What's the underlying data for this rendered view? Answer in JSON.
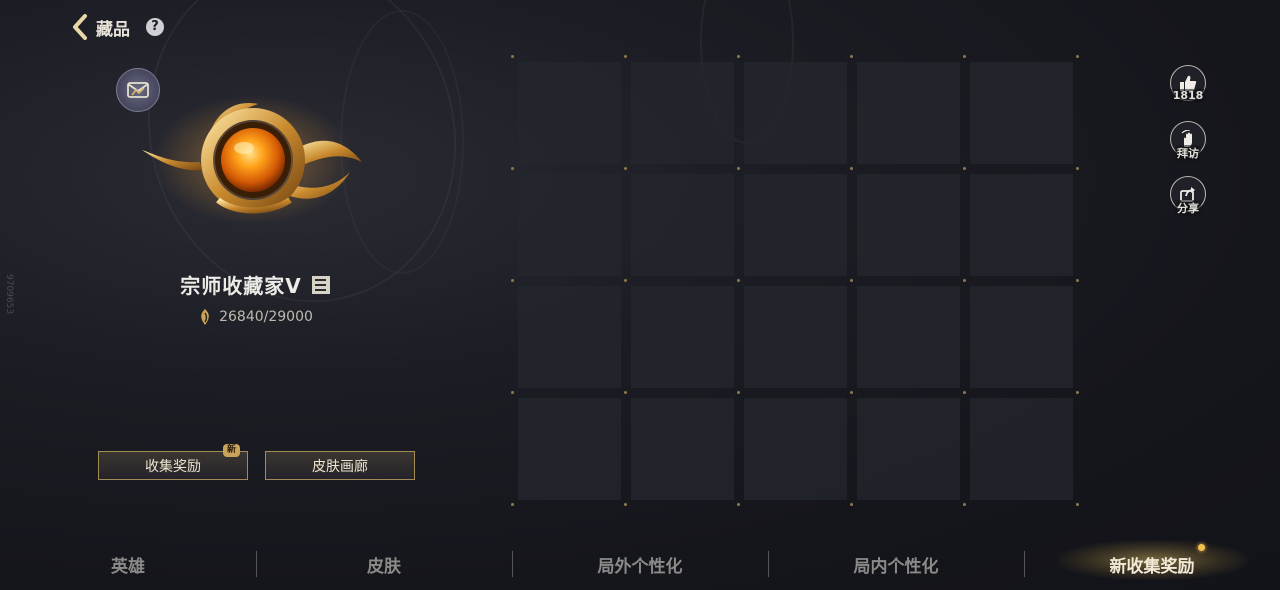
{
  "header": {
    "title": "藏品"
  },
  "profile": {
    "rank_title": "宗师收藏家Ⅴ",
    "points_current": 26840,
    "points_target": 29000,
    "points_text": "26840/29000"
  },
  "buttons": {
    "collect_reward": "收集奖励",
    "new_badge": "新",
    "skin_gallery": "皮肤画廊"
  },
  "side_actions": {
    "like_count": "1818",
    "visit_label": "拜访",
    "share_label": "分享"
  },
  "bottom_nav": {
    "tabs": [
      {
        "label": "英雄",
        "active": false
      },
      {
        "label": "皮肤",
        "active": false
      },
      {
        "label": "局外个性化",
        "active": false
      },
      {
        "label": "局内个性化",
        "active": false
      },
      {
        "label": "新收集奖励",
        "active": true
      }
    ]
  },
  "side_watermark": "9709653",
  "colors": {
    "accent_gold": "#c9a35a",
    "active_dot": "#f3c04c",
    "background": "#15161c"
  }
}
